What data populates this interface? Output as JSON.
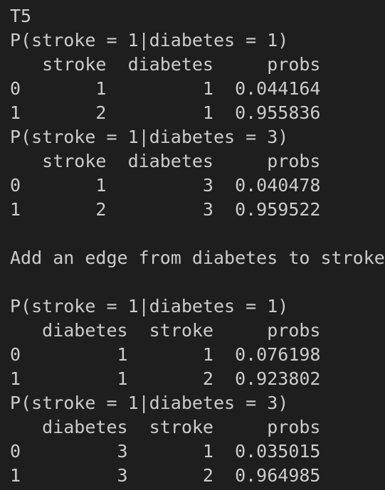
{
  "terminal": {
    "lines": [
      "T5",
      "P(stroke = 1|diabetes = 1)",
      "   stroke  diabetes     probs",
      "0       1         1  0.044164",
      "1       2         1  0.955836",
      "P(stroke = 1|diabetes = 3)",
      "   stroke  diabetes     probs",
      "0       1         3  0.040478",
      "1       2         3  0.959522",
      "",
      "Add an edge from diabetes to stroke",
      "",
      "P(stroke = 1|diabetes = 1)",
      "   diabetes  stroke     probs",
      "0         1       1  0.076198",
      "1         1       2  0.923802",
      "P(stroke = 1|diabetes = 3)",
      "   diabetes  stroke     probs",
      "0         3       1  0.035015",
      "1         3       2  0.964985"
    ]
  },
  "colors": {
    "background": "#1e1e1e",
    "text": "#cccccc"
  }
}
